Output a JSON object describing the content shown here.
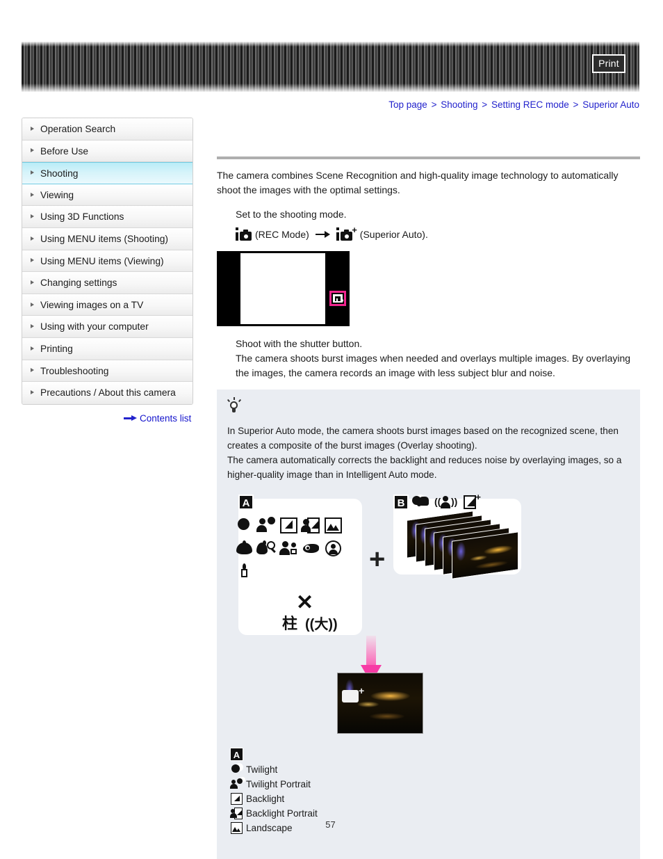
{
  "header": {
    "print_label": "Print"
  },
  "breadcrumb": {
    "items": [
      "Top page",
      "Shooting",
      "Setting REC mode",
      "Superior Auto"
    ],
    "separator": ">"
  },
  "sidebar": {
    "items": [
      {
        "label": "Operation Search",
        "active": false
      },
      {
        "label": "Before Use",
        "active": false
      },
      {
        "label": "Shooting",
        "active": true
      },
      {
        "label": "Viewing",
        "active": false
      },
      {
        "label": "Using 3D Functions",
        "active": false
      },
      {
        "label": "Using MENU items (Shooting)",
        "active": false
      },
      {
        "label": "Using MENU items (Viewing)",
        "active": false
      },
      {
        "label": "Changing settings",
        "active": false
      },
      {
        "label": "Viewing images on a TV",
        "active": false
      },
      {
        "label": "Using with your computer",
        "active": false
      },
      {
        "label": "Printing",
        "active": false
      },
      {
        "label": "Troubleshooting",
        "active": false
      },
      {
        "label": "Precautions / About this camera",
        "active": false
      }
    ],
    "contents_list_label": "Contents list"
  },
  "main": {
    "intro": "The camera combines Scene Recognition and high-quality image technology to automatically shoot the images with the optimal settings.",
    "step1": "Set to the shooting mode.",
    "mode_line": {
      "rec_mode_label": "(REC Mode)",
      "superior_auto_label": "(Superior Auto)."
    },
    "step2": "Shoot with the shutter button.",
    "step2_detail": "The camera shoots burst images when needed and overlays multiple images. By overlaying the images, the camera records an image with less subject blur and noise."
  },
  "tip": {
    "paragraph1": "In Superior Auto mode, the camera shoots burst images based on the recognized scene, then creates a composite of the burst images (Overlay shooting).",
    "paragraph2": "The camera automatically corrects the backlight and reduces noise by overlaying images, so a higher-quality image than in Intelligent Auto mode."
  },
  "diagram": {
    "badge_a": "A",
    "badge_b": "B",
    "plus_symbol": "+",
    "panel_a_icons": [
      "twilight-icon",
      "twilight-portrait-icon",
      "backlight-icon",
      "backlight-portrait-icon",
      "landscape-icon",
      "macro-icon",
      "macro-magnifier-icon",
      "portrait-icon",
      "eye-icon",
      "circle-portrait-icon",
      "candle-icon"
    ],
    "panel_a_bottom_icons": [
      "tripod-icon",
      "x-mark-icon",
      "movement-icon"
    ],
    "panel_b_icons": [
      "twilight-handheld-icon",
      "motion-person-icon",
      "backlight-plus-icon"
    ],
    "stack_count": 6
  },
  "legend": {
    "badge": "A",
    "rows": [
      {
        "icon": "twilight-icon",
        "label": "Twilight"
      },
      {
        "icon": "twilight-portrait-icon",
        "label": "Twilight Portrait"
      },
      {
        "icon": "backlight-icon",
        "label": "Backlight"
      },
      {
        "icon": "backlight-portrait-icon",
        "label": "Backlight Portrait"
      },
      {
        "icon": "landscape-icon",
        "label": "Landscape"
      }
    ]
  },
  "footer": {
    "page_number": "57"
  },
  "colors": {
    "link": "#2222cc",
    "accent_pink": "#f0268e",
    "tip_bg": "#eaedf2",
    "active_nav": "#b9ecf7"
  }
}
